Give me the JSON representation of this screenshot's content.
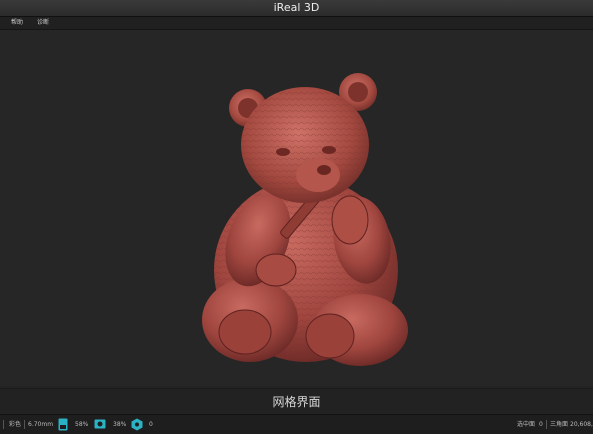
{
  "window": {
    "title": "iReal 3D"
  },
  "menu": {
    "items": [
      {
        "label": "帮助"
      },
      {
        "label": "诊断"
      }
    ]
  },
  "caption": "网格界面",
  "status": {
    "left_mode": "彩色",
    "left_distance": "6.70mm",
    "storage_percent": "58%",
    "camera_percent": "38%",
    "hex_count": "0",
    "selected_label": "选中面",
    "selected_value": "0",
    "triangles_label": "三角面",
    "triangles_value": "20,608,"
  },
  "colors": {
    "model": "#a0463f",
    "model_highlight": "#c86a60",
    "model_shadow": "#5e2220",
    "accent_icon": "#2bb3c4"
  },
  "icons": [
    "storage-icon",
    "camera-icon",
    "hexagon-icon"
  ]
}
